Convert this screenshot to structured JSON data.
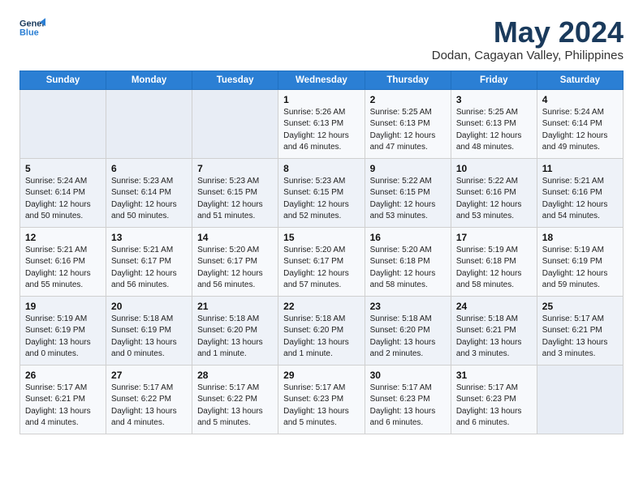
{
  "logo": {
    "line1": "General",
    "line2": "Blue"
  },
  "title": "May 2024",
  "subtitle": "Dodan, Cagayan Valley, Philippines",
  "weekdays": [
    "Sunday",
    "Monday",
    "Tuesday",
    "Wednesday",
    "Thursday",
    "Friday",
    "Saturday"
  ],
  "weeks": [
    [
      null,
      null,
      null,
      {
        "day": 1,
        "sunrise": "5:26 AM",
        "sunset": "6:13 PM",
        "daylight": "12 hours and 46 minutes."
      },
      {
        "day": 2,
        "sunrise": "5:25 AM",
        "sunset": "6:13 PM",
        "daylight": "12 hours and 47 minutes."
      },
      {
        "day": 3,
        "sunrise": "5:25 AM",
        "sunset": "6:13 PM",
        "daylight": "12 hours and 48 minutes."
      },
      {
        "day": 4,
        "sunrise": "5:24 AM",
        "sunset": "6:14 PM",
        "daylight": "12 hours and 49 minutes."
      }
    ],
    [
      {
        "day": 5,
        "sunrise": "5:24 AM",
        "sunset": "6:14 PM",
        "daylight": "12 hours and 50 minutes."
      },
      {
        "day": 6,
        "sunrise": "5:23 AM",
        "sunset": "6:14 PM",
        "daylight": "12 hours and 50 minutes."
      },
      {
        "day": 7,
        "sunrise": "5:23 AM",
        "sunset": "6:15 PM",
        "daylight": "12 hours and 51 minutes."
      },
      {
        "day": 8,
        "sunrise": "5:23 AM",
        "sunset": "6:15 PM",
        "daylight": "12 hours and 52 minutes."
      },
      {
        "day": 9,
        "sunrise": "5:22 AM",
        "sunset": "6:15 PM",
        "daylight": "12 hours and 53 minutes."
      },
      {
        "day": 10,
        "sunrise": "5:22 AM",
        "sunset": "6:16 PM",
        "daylight": "12 hours and 53 minutes."
      },
      {
        "day": 11,
        "sunrise": "5:21 AM",
        "sunset": "6:16 PM",
        "daylight": "12 hours and 54 minutes."
      }
    ],
    [
      {
        "day": 12,
        "sunrise": "5:21 AM",
        "sunset": "6:16 PM",
        "daylight": "12 hours and 55 minutes."
      },
      {
        "day": 13,
        "sunrise": "5:21 AM",
        "sunset": "6:17 PM",
        "daylight": "12 hours and 56 minutes."
      },
      {
        "day": 14,
        "sunrise": "5:20 AM",
        "sunset": "6:17 PM",
        "daylight": "12 hours and 56 minutes."
      },
      {
        "day": 15,
        "sunrise": "5:20 AM",
        "sunset": "6:17 PM",
        "daylight": "12 hours and 57 minutes."
      },
      {
        "day": 16,
        "sunrise": "5:20 AM",
        "sunset": "6:18 PM",
        "daylight": "12 hours and 58 minutes."
      },
      {
        "day": 17,
        "sunrise": "5:19 AM",
        "sunset": "6:18 PM",
        "daylight": "12 hours and 58 minutes."
      },
      {
        "day": 18,
        "sunrise": "5:19 AM",
        "sunset": "6:19 PM",
        "daylight": "12 hours and 59 minutes."
      }
    ],
    [
      {
        "day": 19,
        "sunrise": "5:19 AM",
        "sunset": "6:19 PM",
        "daylight": "13 hours and 0 minutes."
      },
      {
        "day": 20,
        "sunrise": "5:18 AM",
        "sunset": "6:19 PM",
        "daylight": "13 hours and 0 minutes."
      },
      {
        "day": 21,
        "sunrise": "5:18 AM",
        "sunset": "6:20 PM",
        "daylight": "13 hours and 1 minute."
      },
      {
        "day": 22,
        "sunrise": "5:18 AM",
        "sunset": "6:20 PM",
        "daylight": "13 hours and 1 minute."
      },
      {
        "day": 23,
        "sunrise": "5:18 AM",
        "sunset": "6:20 PM",
        "daylight": "13 hours and 2 minutes."
      },
      {
        "day": 24,
        "sunrise": "5:18 AM",
        "sunset": "6:21 PM",
        "daylight": "13 hours and 3 minutes."
      },
      {
        "day": 25,
        "sunrise": "5:17 AM",
        "sunset": "6:21 PM",
        "daylight": "13 hours and 3 minutes."
      }
    ],
    [
      {
        "day": 26,
        "sunrise": "5:17 AM",
        "sunset": "6:21 PM",
        "daylight": "13 hours and 4 minutes."
      },
      {
        "day": 27,
        "sunrise": "5:17 AM",
        "sunset": "6:22 PM",
        "daylight": "13 hours and 4 minutes."
      },
      {
        "day": 28,
        "sunrise": "5:17 AM",
        "sunset": "6:22 PM",
        "daylight": "13 hours and 5 minutes."
      },
      {
        "day": 29,
        "sunrise": "5:17 AM",
        "sunset": "6:23 PM",
        "daylight": "13 hours and 5 minutes."
      },
      {
        "day": 30,
        "sunrise": "5:17 AM",
        "sunset": "6:23 PM",
        "daylight": "13 hours and 6 minutes."
      },
      {
        "day": 31,
        "sunrise": "5:17 AM",
        "sunset": "6:23 PM",
        "daylight": "13 hours and 6 minutes."
      },
      null
    ]
  ],
  "labels": {
    "sunrise_prefix": "Sunrise:",
    "sunset_prefix": "Sunset:",
    "daylight_prefix": "Daylight:"
  }
}
